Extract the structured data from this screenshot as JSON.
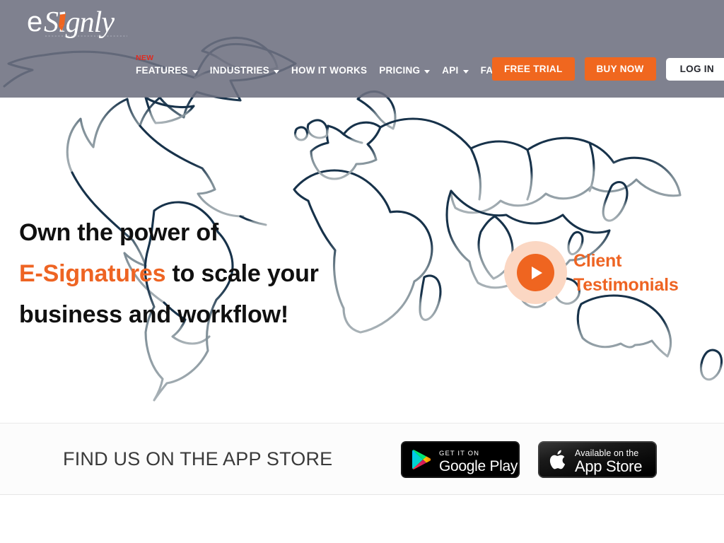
{
  "brand": {
    "logo_text_primary": "e",
    "logo_text_script": "Signly",
    "accent_orange": "#ee6423",
    "header_gray": "#6d707f",
    "map_navy": "#17324a",
    "map_gray": "#9aa5ab",
    "badge_red": "#e02a20"
  },
  "header": {
    "nav": [
      {
        "label": "FEATURES",
        "badge": "NEW",
        "has_caret": true
      },
      {
        "label": "INDUSTRIES",
        "badge": "",
        "has_caret": true
      },
      {
        "label": "HOW IT WORKS",
        "badge": "",
        "has_caret": false
      },
      {
        "label": "PRICING",
        "badge": "",
        "has_caret": true
      },
      {
        "label": "API",
        "badge": "",
        "has_caret": true
      },
      {
        "label": "FAQ",
        "badge": "",
        "has_caret": false
      }
    ],
    "actions": {
      "free_trial": "FREE TRIAL",
      "buy_now": "BUY NOW",
      "log_in": "LOG IN"
    }
  },
  "hero": {
    "line1": "Own the power of",
    "line2_highlight": "E-Signatures",
    "line2_rest": " to scale your",
    "line3": "business and workflow!",
    "testimonial_line1": "Client",
    "testimonial_line2": "Testimonials",
    "play_icon": "play-triangle-icon"
  },
  "appstore": {
    "title": "FIND US ON THE APP STORE",
    "google": {
      "small_text": "GET IT ON",
      "large_text": "Google Play",
      "icon": "google-play-triangle-icon"
    },
    "apple": {
      "small_text": "Available on the",
      "large_text": "App Store",
      "icon": "apple-logo-icon"
    }
  }
}
